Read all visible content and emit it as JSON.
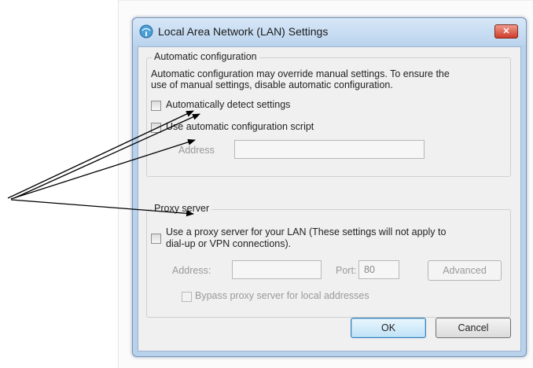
{
  "dialog": {
    "title": "Local Area Network (LAN) Settings",
    "close_icon": "close-icon",
    "title_icon": "network-settings-icon"
  },
  "automatic_configuration": {
    "label": "Automatic configuration",
    "description_line1": "Automatic configuration may override manual settings.  To ensure the",
    "description_line2": "use of manual settings, disable automatic configuration.",
    "detect_label": "Automatically detect settings",
    "detect_checked": false,
    "script_label": "Use automatic configuration script",
    "script_checked": false,
    "address_label": "Address",
    "address_value": ""
  },
  "proxy_server": {
    "label": "Proxy server",
    "use_proxy_line1": "Use a proxy server for your LAN (These settings will not apply to",
    "use_proxy_line2": "dial-up or VPN connections).",
    "use_proxy_checked": false,
    "address_label": "Address:",
    "address_value": "",
    "port_label": "Port:",
    "port_value": "80",
    "advanced_label": "Advanced",
    "bypass_label": "Bypass proxy server for local addresses",
    "bypass_checked": false
  },
  "buttons": {
    "ok": "OK",
    "cancel": "Cancel"
  },
  "annotation": {
    "arrow_color": "#000000",
    "arrow_count": 4
  }
}
